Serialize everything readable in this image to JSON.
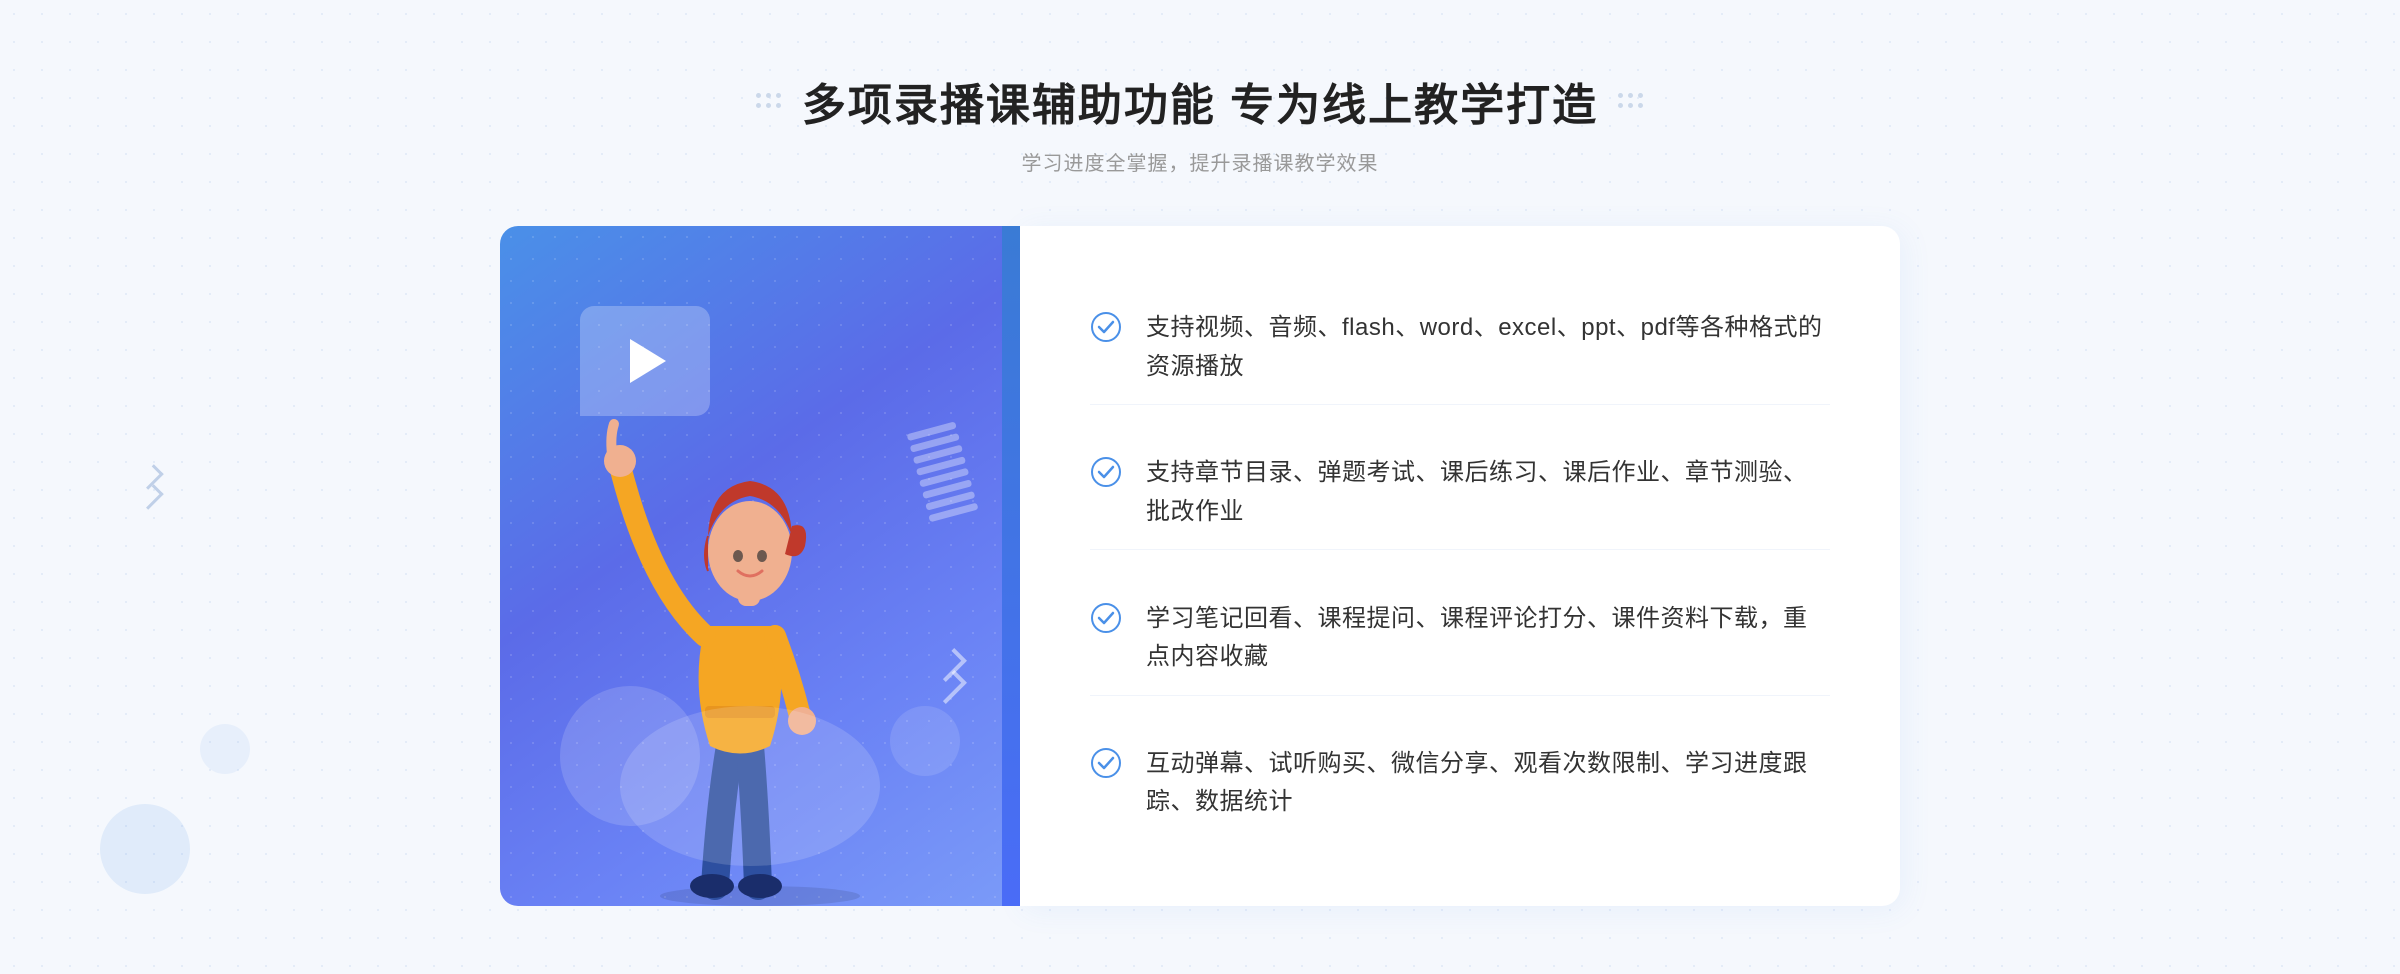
{
  "header": {
    "title": "多项录播课辅助功能 专为线上教学打造",
    "subtitle": "学习进度全掌握，提升录播课教学效果"
  },
  "features": [
    {
      "id": 1,
      "text": "支持视频、音频、flash、word、excel、ppt、pdf等各种格式的资源播放"
    },
    {
      "id": 2,
      "text": "支持章节目录、弹题考试、课后练习、课后作业、章节测验、批改作业"
    },
    {
      "id": 3,
      "text": "学习笔记回看、课程提问、课程评论打分、课件资料下载，重点内容收藏"
    },
    {
      "id": 4,
      "text": "互动弹幕、试听购买、微信分享、观看次数限制、学习进度跟踪、数据统计"
    }
  ],
  "icons": {
    "check": "check-circle-icon",
    "play": "play-icon",
    "chevron_left": "chevron-left-icon"
  },
  "colors": {
    "primary": "#4a90e8",
    "primary_dark": "#3a7bd5",
    "accent": "#5b6be8",
    "text_dark": "#222222",
    "text_main": "#333333",
    "text_sub": "#999999",
    "bg": "#f5f8fd"
  }
}
